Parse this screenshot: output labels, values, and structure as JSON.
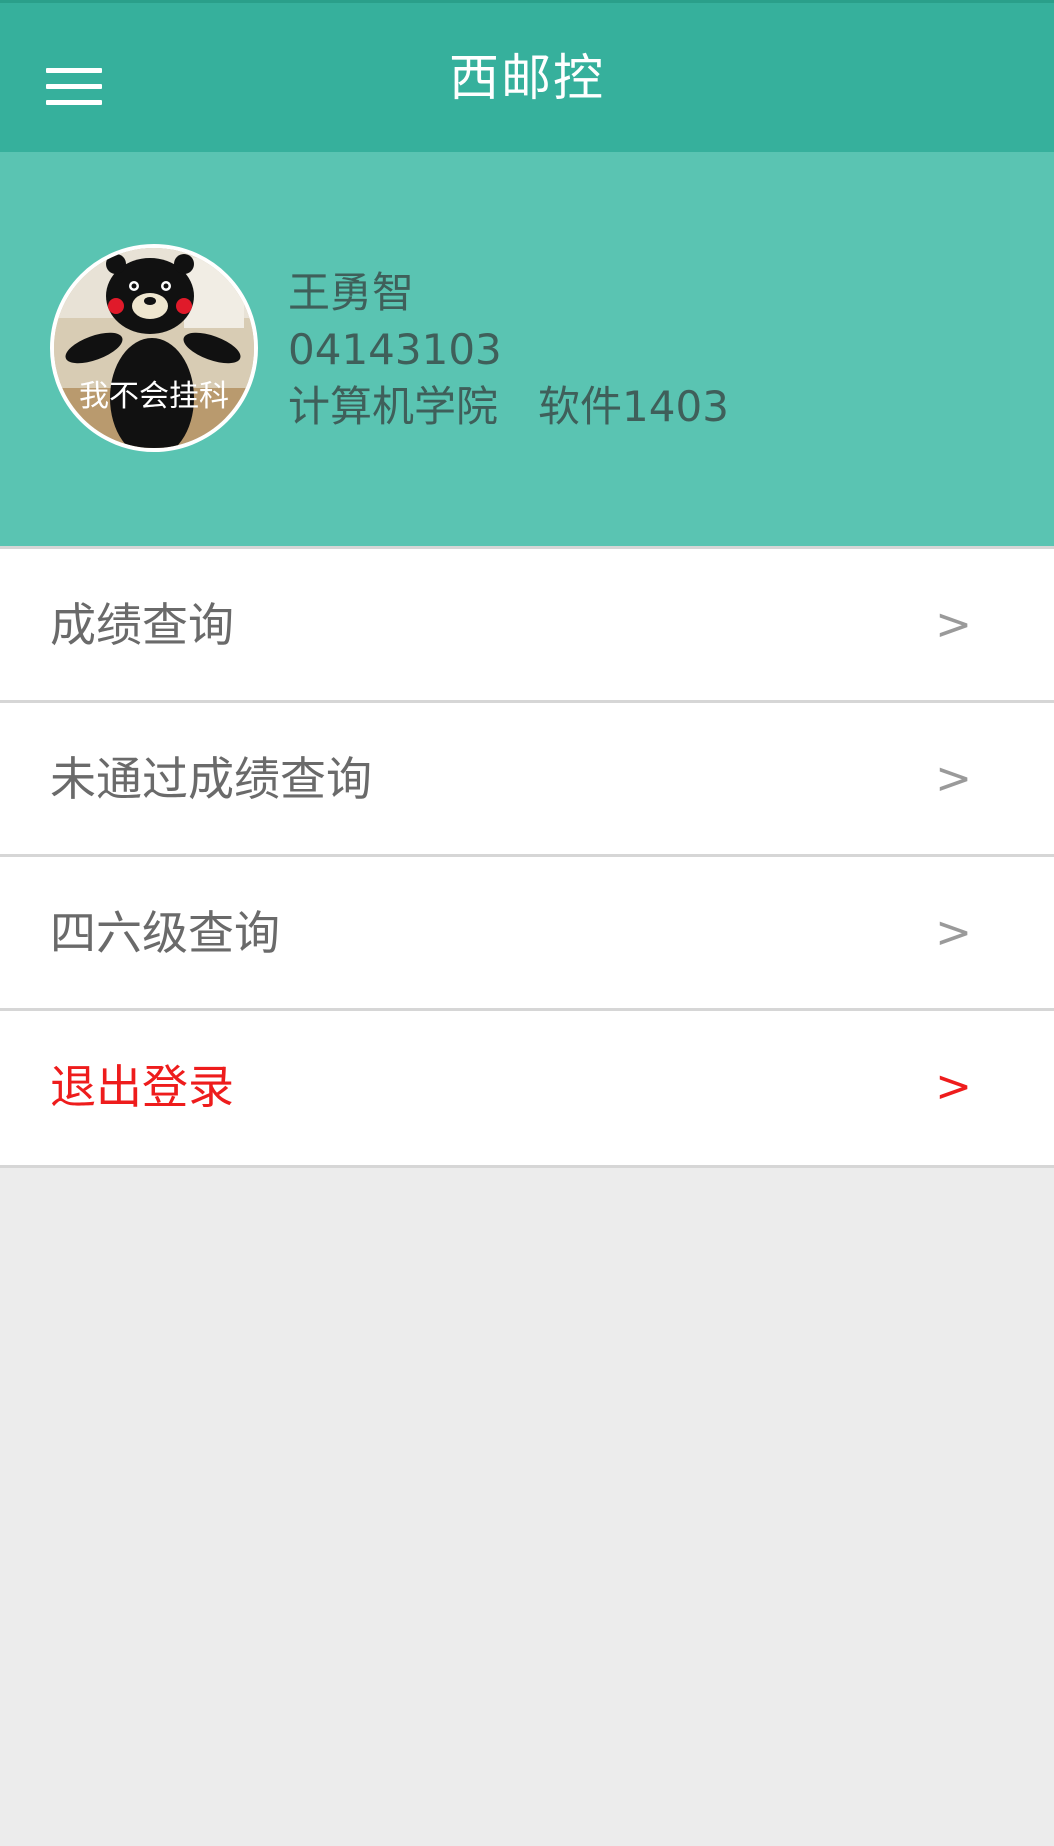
{
  "header": {
    "title": "西邮控"
  },
  "profile": {
    "name": "王勇智",
    "student_id": "04143103",
    "department_class": "计算机学院   软件1403",
    "avatar_caption": "我不会挂科"
  },
  "menu": [
    {
      "label": "成绩查询",
      "chevron": ">"
    },
    {
      "label": "未通过成绩查询",
      "chevron": ">"
    },
    {
      "label": "四六级查询",
      "chevron": ">"
    },
    {
      "label": "退出登录",
      "chevron": ">"
    }
  ],
  "colors": {
    "header": "#36b09c",
    "profile_bg": "#5ac4b2",
    "danger": "#ee1c1c",
    "page_bg": "#ececec"
  }
}
